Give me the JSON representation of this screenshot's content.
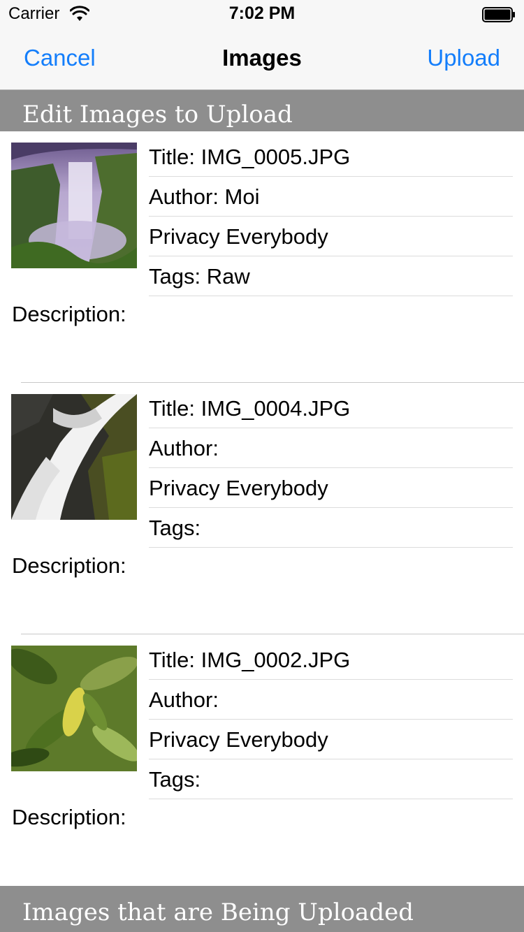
{
  "status_bar": {
    "carrier": "Carrier",
    "time": "7:02 PM"
  },
  "nav": {
    "cancel_label": "Cancel",
    "title": "Images",
    "upload_label": "Upload"
  },
  "sections": {
    "edit_header": "Edit Images to Upload",
    "uploading_header": "Images that are Being Uploaded"
  },
  "images": [
    {
      "title": "Title: IMG_0005.JPG",
      "author": "Author: Moi",
      "privacy": "Privacy Everybody",
      "tags": "Tags: Raw",
      "description": "Description:"
    },
    {
      "title": "Title: IMG_0004.JPG",
      "author": "Author:",
      "privacy": "Privacy Everybody",
      "tags": "Tags:",
      "description": "Description:"
    },
    {
      "title": "Title: IMG_0002.JPG",
      "author": "Author:",
      "privacy": "Privacy Everybody",
      "tags": "Tags:",
      "description": "Description:"
    }
  ],
  "colors": {
    "accent": "#147efb",
    "section_header_bg": "#8e8e8e",
    "bar_bg": "#f7f7f7"
  },
  "icons": [
    "wifi-icon",
    "battery-icon"
  ]
}
